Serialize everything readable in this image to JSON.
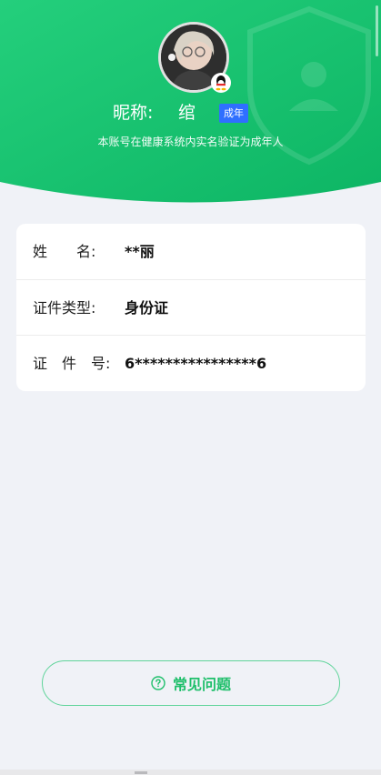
{
  "colors": {
    "header_green_light": "#29d07f",
    "header_green_dark": "#0fb865",
    "age_badge": "#2f6fff",
    "faq_accent": "#1fbf6b",
    "page_bg": "#f0f2f7"
  },
  "profile": {
    "avatar_icon": "avatar-photo",
    "platform_badge_icon": "qq-penguin-icon",
    "nickname_label": "昵称:",
    "nickname_value": "绾",
    "age_badge": "成年",
    "verify_note": "本账号在健康系统内实名验证为成年人"
  },
  "identity": {
    "rows": [
      {
        "label": "姓　　名:",
        "value": "**丽"
      },
      {
        "label": "证件类型:",
        "value": "身份证"
      },
      {
        "label": "证　件　号:",
        "value": "6****************6"
      }
    ]
  },
  "faq": {
    "icon": "question-circle-icon",
    "label": "常见问题"
  }
}
